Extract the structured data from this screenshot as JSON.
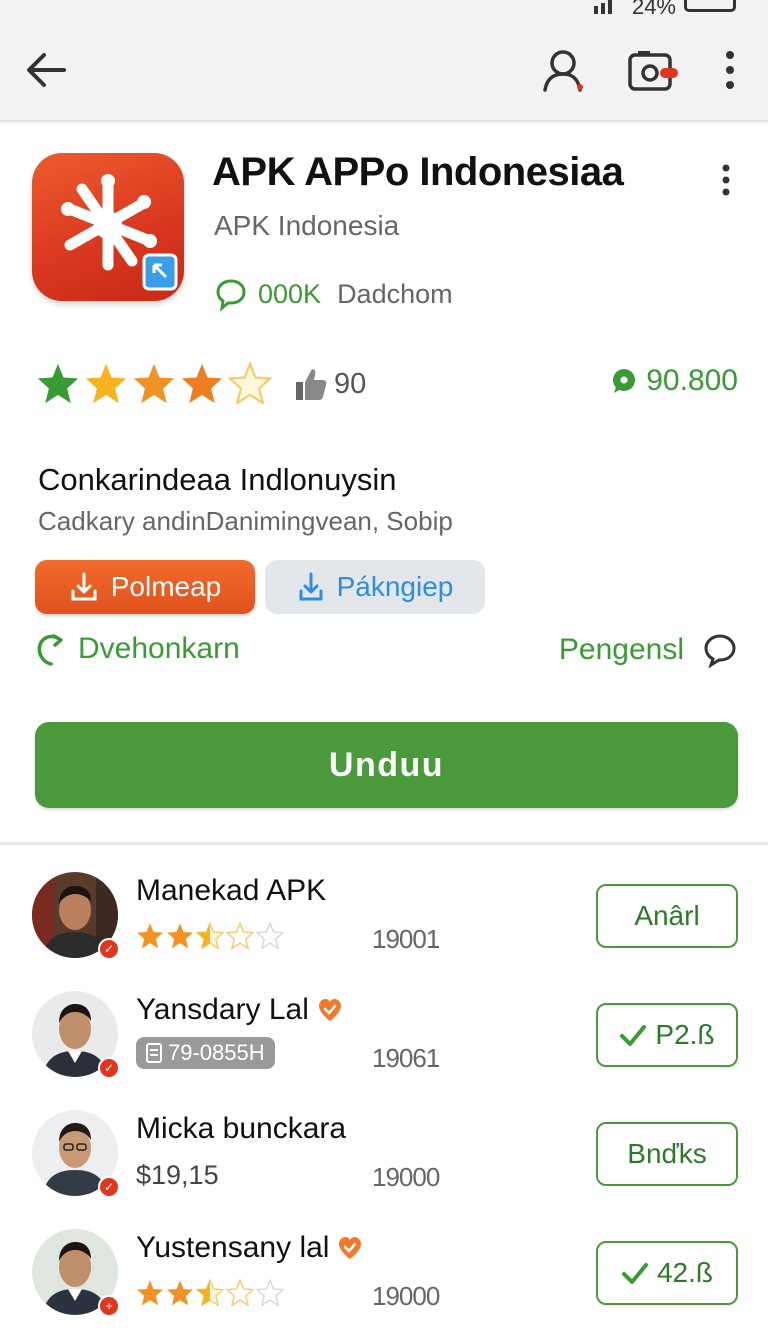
{
  "status_bar": {
    "battery_text": "24%"
  },
  "app": {
    "title": "APK APPo Indonesiaa",
    "developer": "APK Indonesia",
    "downloads": "000K",
    "downloads_label": "Dadchom",
    "rating_stars": 4,
    "reviews_count": "90",
    "rating_value": "90.800",
    "description_title": "Conkarindeaa Indlonuysin",
    "description_subtitle": "Cadkary andinDanimingvean, Sobip"
  },
  "chips": {
    "orange_label": "Polmeap",
    "grey_label": "Pákngiep"
  },
  "links": {
    "left_label": "Dvehonkarn",
    "right_label": "Pengensl"
  },
  "install_button": {
    "label": "Unduu"
  },
  "items": [
    {
      "name": "Manekad APK",
      "rating": 2.5,
      "number": "19001",
      "button_label": "Anârl",
      "button_check": false,
      "name_badge": false
    },
    {
      "name": "Yansdary Lal",
      "pill_text": "79-0855H",
      "number": "19061",
      "button_label": "P2.ß",
      "button_check": true,
      "name_badge": true
    },
    {
      "name": "Micka bunckara",
      "price": "$19,15",
      "number": "19000",
      "button_label": "Bnďks",
      "button_check": false,
      "name_badge": false
    },
    {
      "name": "Yustensany lal",
      "rating": 2.5,
      "number": "19000",
      "button_label": "42.ß",
      "button_check": true,
      "name_badge": true
    }
  ],
  "colors": {
    "accent_green": "#4a9a3c",
    "text_green": "#3a9b35",
    "orange": "#e1521e",
    "star_orange": "#f29224",
    "star_green": "#3a9b35",
    "blue": "#2b8fe0"
  },
  "icons": {
    "back": "arrow-left-icon",
    "profile": "user-icon",
    "camera": "camera-icon",
    "menu": "more-vertical-icon"
  }
}
